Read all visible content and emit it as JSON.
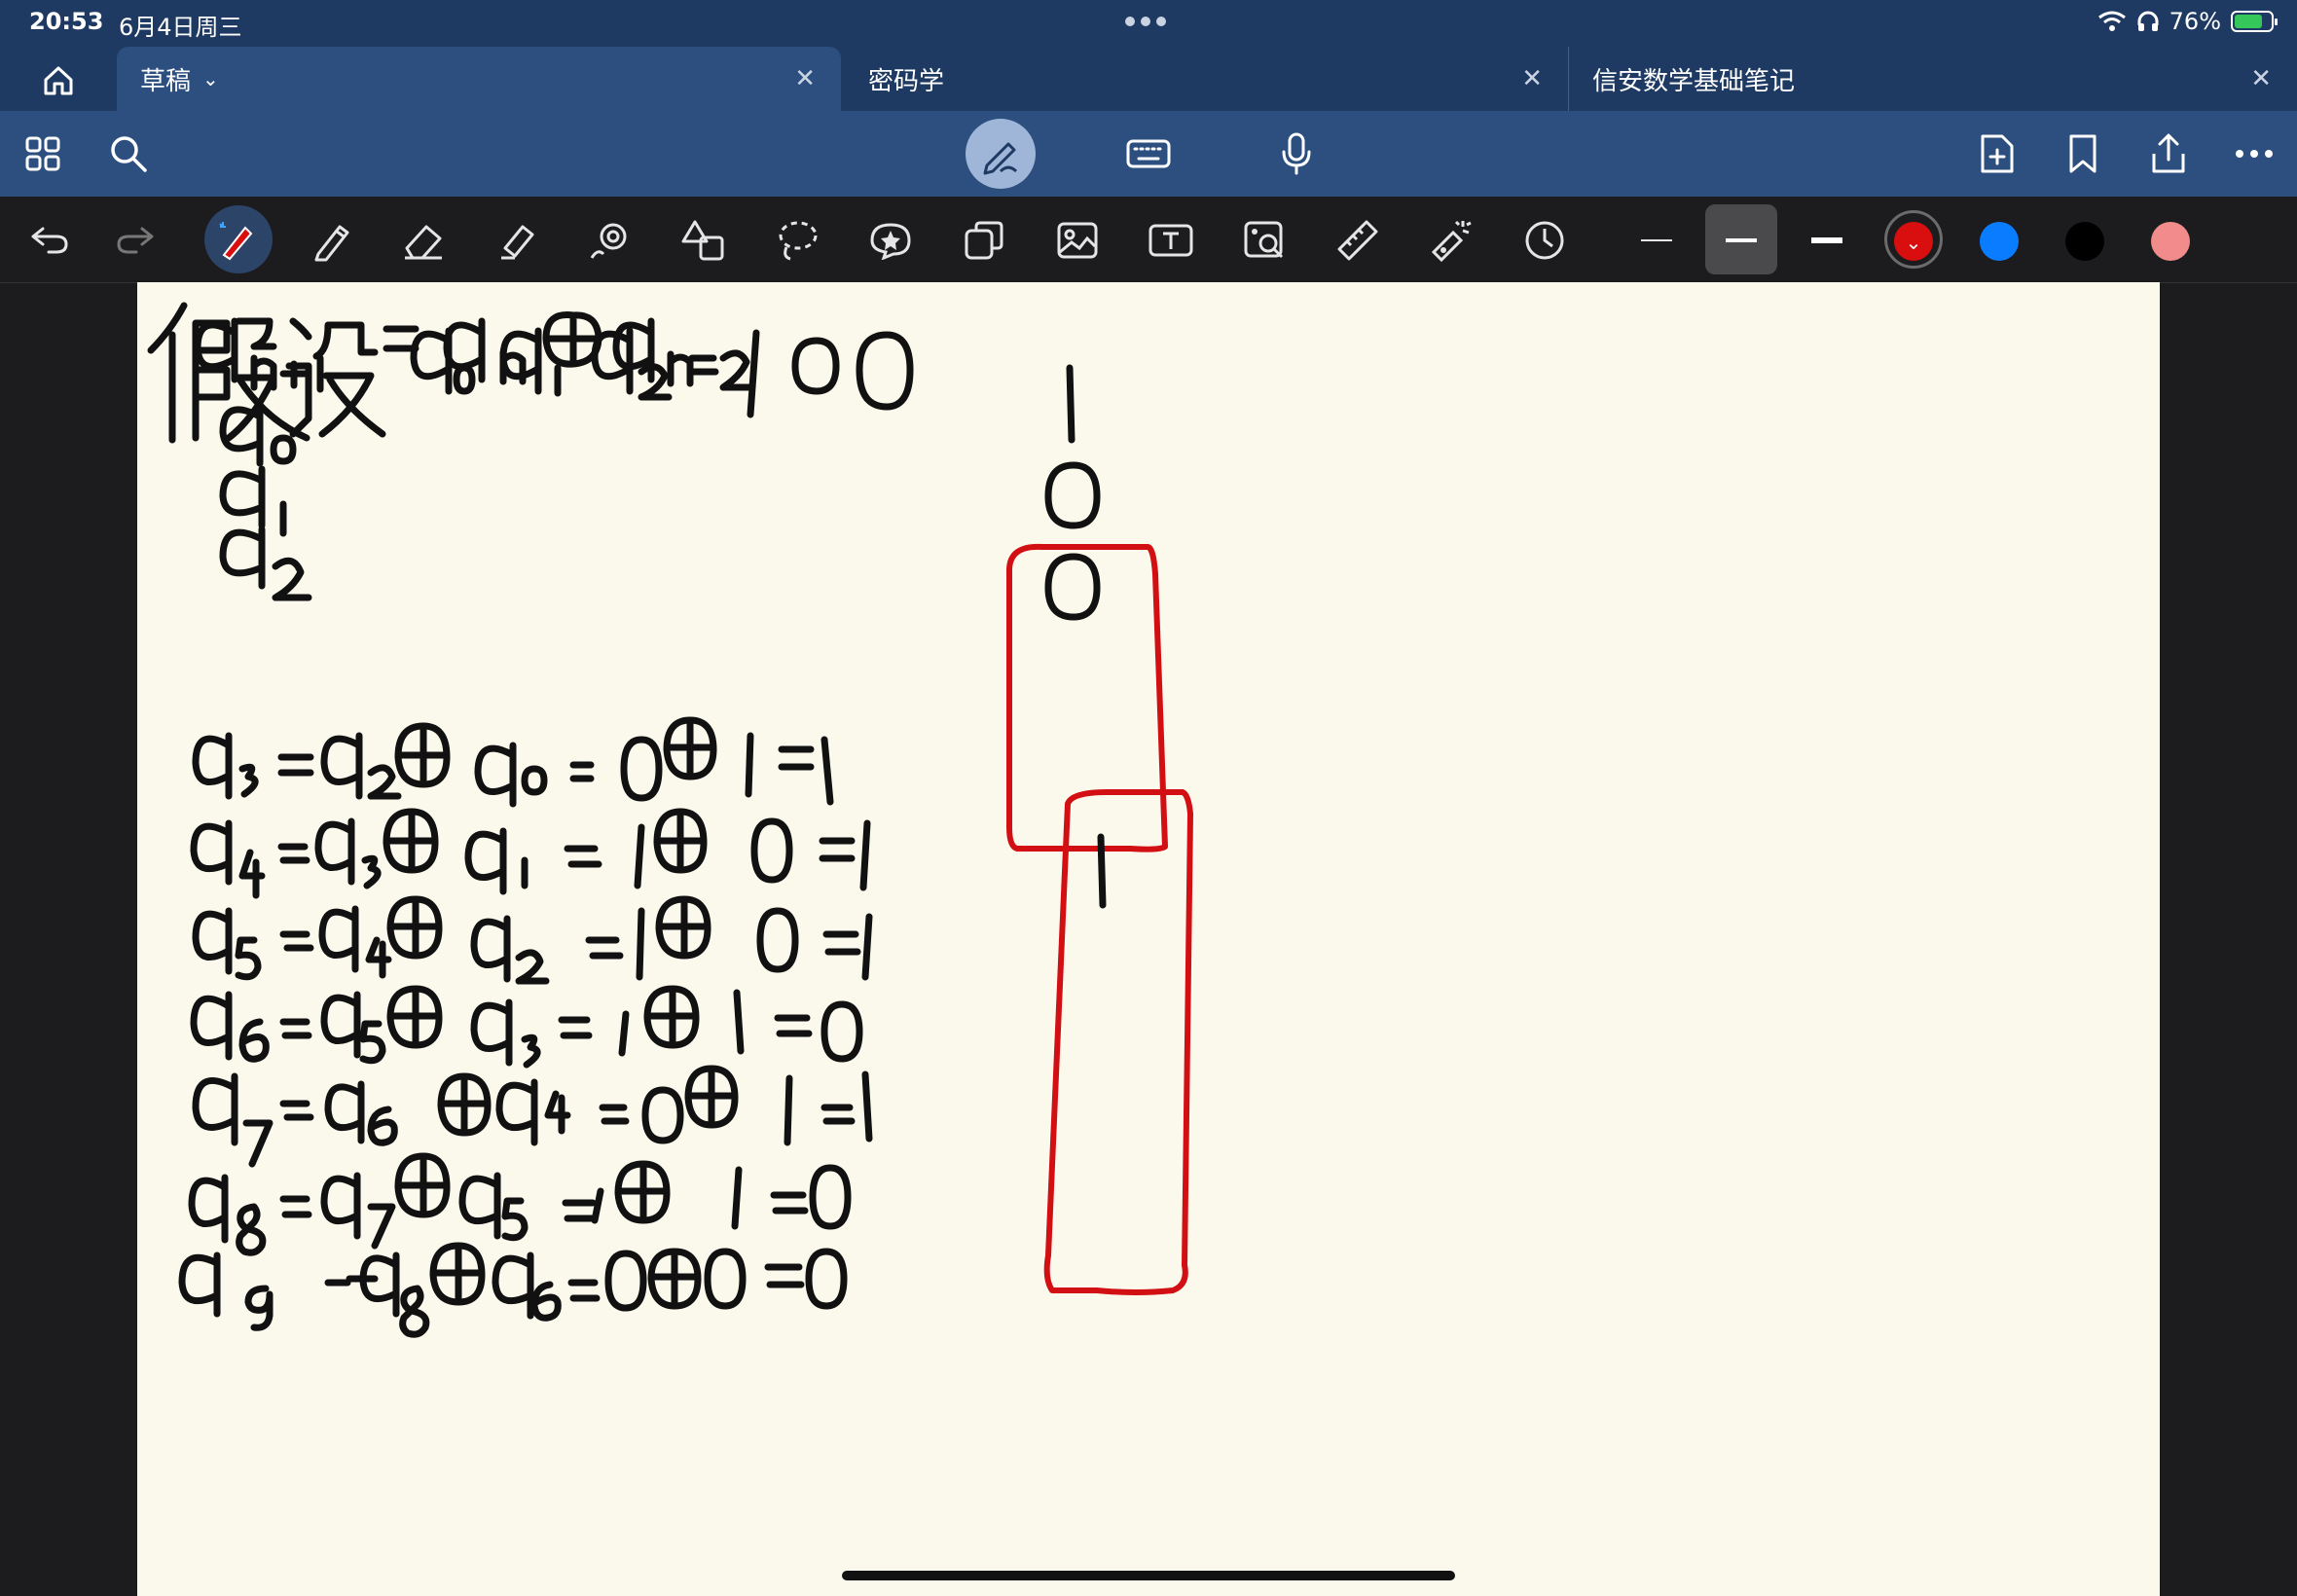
{
  "status": {
    "time": "20:53",
    "date": "6月4日周三",
    "battery": "76%",
    "wifi_icon": "wifi-icon",
    "headphone_icon": "headphones-icon"
  },
  "tabs": [
    {
      "label": "草稿",
      "active": true
    },
    {
      "label": "密码学",
      "active": false
    },
    {
      "label": "信安数学基础笔记",
      "active": false
    }
  ],
  "toolbar": {
    "left_icons": [
      "grid-icon",
      "search-icon"
    ],
    "center_icons": [
      "pen-mode-icon",
      "keyboard-icon",
      "microphone-icon"
    ],
    "right_icons": [
      "add-page-icon",
      "bookmark-icon",
      "share-icon",
      "more-icon"
    ]
  },
  "drawing_tools": [
    "undo",
    "redo",
    "pen",
    "pencil",
    "eraser",
    "highlighter",
    "shape",
    "shape-recognize",
    "lasso",
    "sticker",
    "elements",
    "image",
    "text",
    "camera",
    "ruler",
    "laser",
    "timer"
  ],
  "colors": [
    "#d90f0f",
    "#0a7cff",
    "#000000",
    "#f28b8b"
  ],
  "note": {
    "lines": [
      "a_{n+1} = a_n ⊕ a_{n-2}",
      "假设 a0 a1 a2 = 1 0 0",
      "a0        1",
      "a1        0",
      "a2        0",
      "a3 = a2 ⊕ a0 = 0 ⊕ 1 = 1",
      "a4 = a3 ⊕ a1 = 1 ⊕ 0 = 1",
      "a5 = a4 ⊕ a2 = 1 ⊕ 0 = 1",
      "a6 = a5 ⊕ a3 = 1 ⊕ 1 = 0",
      "a7 = a6 ⊕ a4 = 0 ⊕ 1 = 1",
      "a8 = a7 ⊕ a5 = 1 ⊕ 1 = 0",
      "a9 = a8 ⊕ a6 = 0 ⊕ 0 = 0"
    ]
  }
}
